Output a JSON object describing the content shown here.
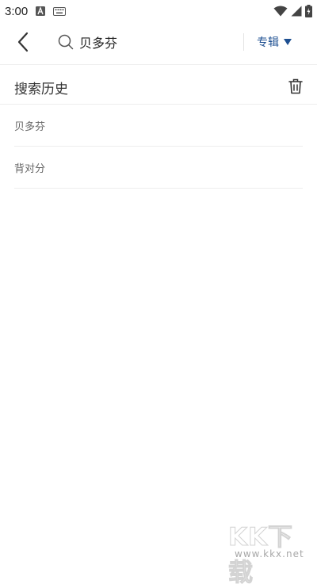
{
  "status_bar": {
    "time": "3:00",
    "icons": [
      "app-a-icon",
      "keyboard-icon",
      "wifi-icon",
      "signal-icon",
      "battery-charging-icon"
    ]
  },
  "header": {
    "back_icon": "chevron-left-icon",
    "search_icon": "search-icon",
    "search_value": "贝多芬",
    "type_label": "专辑",
    "type_dropdown_icon": "triangle-down-icon",
    "accent_color": "#1d4f91"
  },
  "history": {
    "title": "搜索历史",
    "clear_icon": "trash-icon",
    "items": [
      {
        "label": "贝多芬"
      },
      {
        "label": "背对分"
      }
    ]
  },
  "watermark": {
    "text": "KK下载",
    "url": "www.kkx.net"
  }
}
